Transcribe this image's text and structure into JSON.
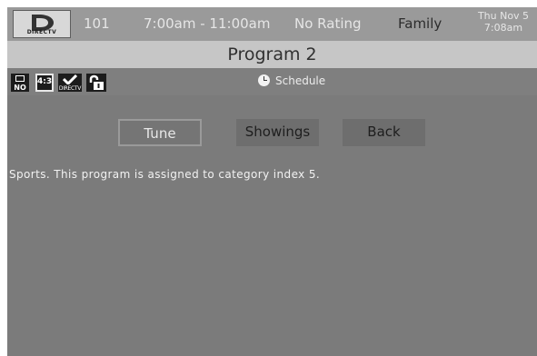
{
  "header": {
    "logo_text": "DIRECTV",
    "channel": "101",
    "time_slot": "7:00am - 11:00am",
    "rating": "No Rating",
    "group": "Family",
    "date": "Thu Nov 5",
    "clock": "7:08am"
  },
  "title": "Program 2",
  "icon_bar": {
    "cc_label": "NO",
    "aspect_label": "4:3",
    "dtv_label": "DIRECTV",
    "schedule_label": "Schedule"
  },
  "buttons": {
    "tune": "Tune",
    "showings": "Showings",
    "back": "Back"
  },
  "description": "Sports. This program is assigned to category index 5."
}
